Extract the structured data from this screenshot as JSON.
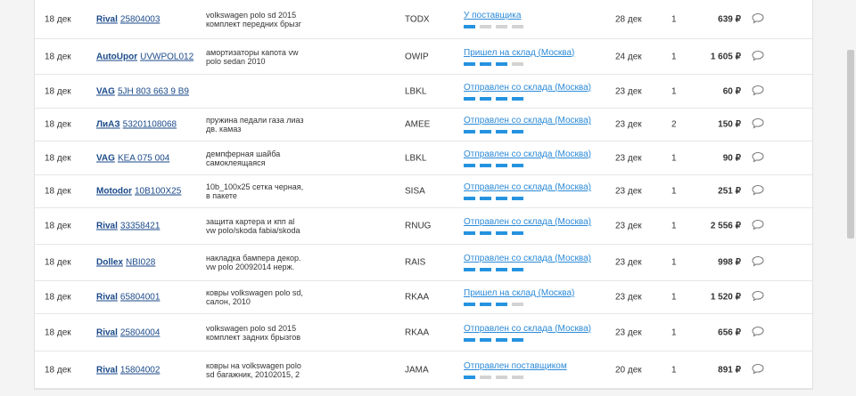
{
  "orders": [
    {
      "date": "18 дек",
      "brand": "Rival",
      "number": "25804003",
      "description": "volkswagen polo sd 2015 комплект передних брызг",
      "supplier_code": "TODX",
      "status": "У поставщика",
      "progress_steps_done": 1,
      "delivery_date": "28 дек",
      "qty": "1",
      "price": "639 ₽"
    },
    {
      "date": "18 дек",
      "brand": "AutoUpor",
      "number": "UVWPOL012",
      "description": "амортизаторы капота vw polo sedan 2010",
      "supplier_code": "OWIP",
      "status": "Пришел на склад (Москва)",
      "progress_steps_done": 3,
      "delivery_date": "24 дек",
      "qty": "1",
      "price": "1 605 ₽"
    },
    {
      "date": "18 дек",
      "brand": "VAG",
      "number": "5JH 803 663 9 B9",
      "description": "",
      "supplier_code": "LBKL",
      "status": "Отправлен со склада (Москва)",
      "progress_steps_done": 4,
      "delivery_date": "23 дек",
      "qty": "1",
      "price": "60 ₽"
    },
    {
      "date": "18 дек",
      "brand": "ЛиАЗ",
      "number": "53201108068",
      "description": "пружина педали газа лиаз дв. камаз",
      "supplier_code": "AMEE",
      "status": "Отправлен со склада (Москва)",
      "progress_steps_done": 4,
      "delivery_date": "23 дек",
      "qty": "2",
      "price": "150 ₽"
    },
    {
      "date": "18 дек",
      "brand": "VAG",
      "number": "KEA 075 004",
      "description": "демпферная шайба самоклеящаяся",
      "supplier_code": "LBKL",
      "status": "Отправлен со склада (Москва)",
      "progress_steps_done": 4,
      "delivery_date": "23 дек",
      "qty": "1",
      "price": "90 ₽"
    },
    {
      "date": "18 дек",
      "brand": "Motodor",
      "number": "10B100X25",
      "description": "10b_100x25 сетка черная, в пакете",
      "supplier_code": "SISA",
      "status": "Отправлен со склада (Москва)",
      "progress_steps_done": 4,
      "delivery_date": "23 дек",
      "qty": "1",
      "price": "251 ₽"
    },
    {
      "date": "18 дек",
      "brand": "Rival",
      "number": "33358421",
      "description": "защита картера и кпп al vw polo/skoda fabia/skoda",
      "supplier_code": "RNUG",
      "status": "Отправлен со склада (Москва)",
      "progress_steps_done": 4,
      "delivery_date": "23 дек",
      "qty": "1",
      "price": "2 556 ₽"
    },
    {
      "date": "18 дек",
      "brand": "Dollex",
      "number": "NBI028",
      "description": "накладка бампера декор. vw polo 20092014 нерж.",
      "supplier_code": "RAIS",
      "status": "Отправлен со склада (Москва)",
      "progress_steps_done": 4,
      "delivery_date": "23 дек",
      "qty": "1",
      "price": "998 ₽"
    },
    {
      "date": "18 дек",
      "brand": "Rival",
      "number": "65804001",
      "description": "ковры volkswagen polo sd, салон, 2010",
      "supplier_code": "RKAA",
      "status": "Пришел на склад (Москва)",
      "progress_steps_done": 3,
      "delivery_date": "23 дек",
      "qty": "1",
      "price": "1 520 ₽"
    },
    {
      "date": "18 дек",
      "brand": "Rival",
      "number": "25804004",
      "description": "volkswagen polo sd 2015 комплект задних брызгов",
      "supplier_code": "RKAA",
      "status": "Отправлен со склада (Москва)",
      "progress_steps_done": 4,
      "delivery_date": "23 дек",
      "qty": "1",
      "price": "656 ₽"
    },
    {
      "date": "18 дек",
      "brand": "Rival",
      "number": "15804002",
      "description": "ковры на volkswagen polo sd багажник, 20102015, 2",
      "supplier_code": "JAMA",
      "status": "Отправлен поставщиком",
      "progress_steps_done": 1,
      "delivery_date": "20 дек",
      "qty": "1",
      "price": "891 ₽"
    }
  ]
}
